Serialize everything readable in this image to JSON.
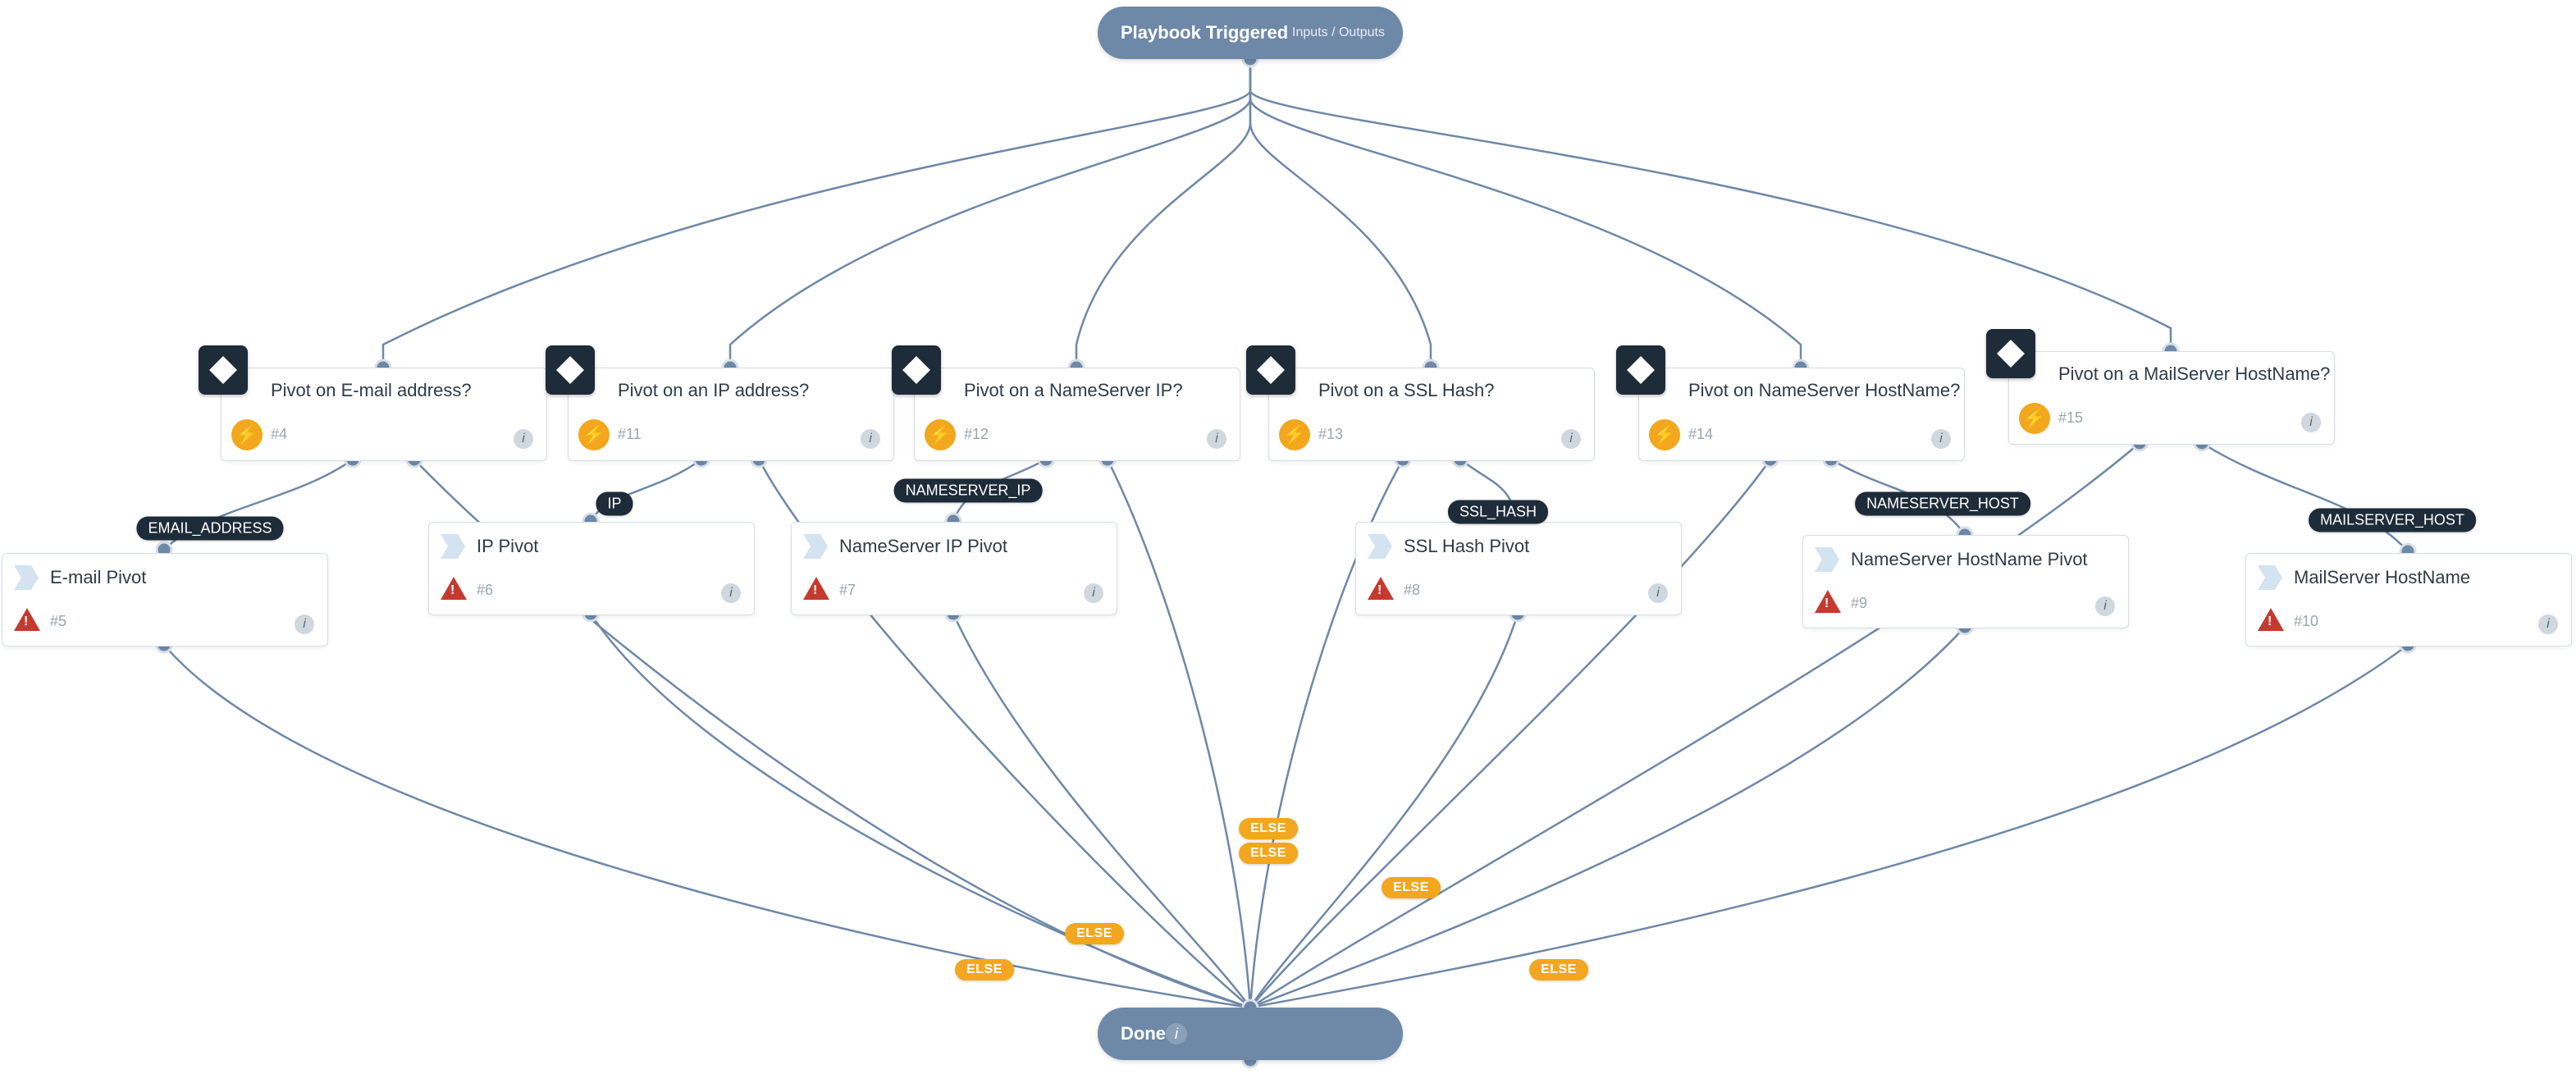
{
  "start": {
    "title": "Playbook Triggered",
    "sub": "Inputs / Outputs"
  },
  "done": {
    "title": "Done"
  },
  "decisions": {
    "d4": {
      "title": "Pivot on E-mail address?",
      "id": "#4"
    },
    "d11": {
      "title": "Pivot on an IP address?",
      "id": "#11"
    },
    "d12": {
      "title": "Pivot on a NameServer IP?",
      "id": "#12"
    },
    "d13": {
      "title": "Pivot on a SSL Hash?",
      "id": "#13"
    },
    "d14": {
      "title": "Pivot on NameServer HostName?",
      "id": "#14"
    },
    "d15": {
      "title": "Pivot on a MailServer HostName?",
      "id": "#15"
    }
  },
  "actions": {
    "a5": {
      "title": "E-mail Pivot",
      "id": "#5"
    },
    "a6": {
      "title": "IP Pivot",
      "id": "#6"
    },
    "a7": {
      "title": "NameServer IP Pivot",
      "id": "#7"
    },
    "a8": {
      "title": "SSL Hash Pivot",
      "id": "#8"
    },
    "a9": {
      "title": "NameServer HostName Pivot",
      "id": "#9"
    },
    "a10": {
      "title": "MailServer HostName",
      "id": "#10"
    }
  },
  "labels": {
    "email": "EMAIL_ADDRESS",
    "ip": "IP",
    "nsip": "NAMESERVER_IP",
    "ssl": "SSL_HASH",
    "nshost": "NAMESERVER_HOST",
    "mailhost": "MAILSERVER_HOST",
    "else": "ELSE"
  },
  "colors": {
    "edge": "#6e88a8",
    "dark": "#1e2b39",
    "accent": "#f2a71e"
  }
}
